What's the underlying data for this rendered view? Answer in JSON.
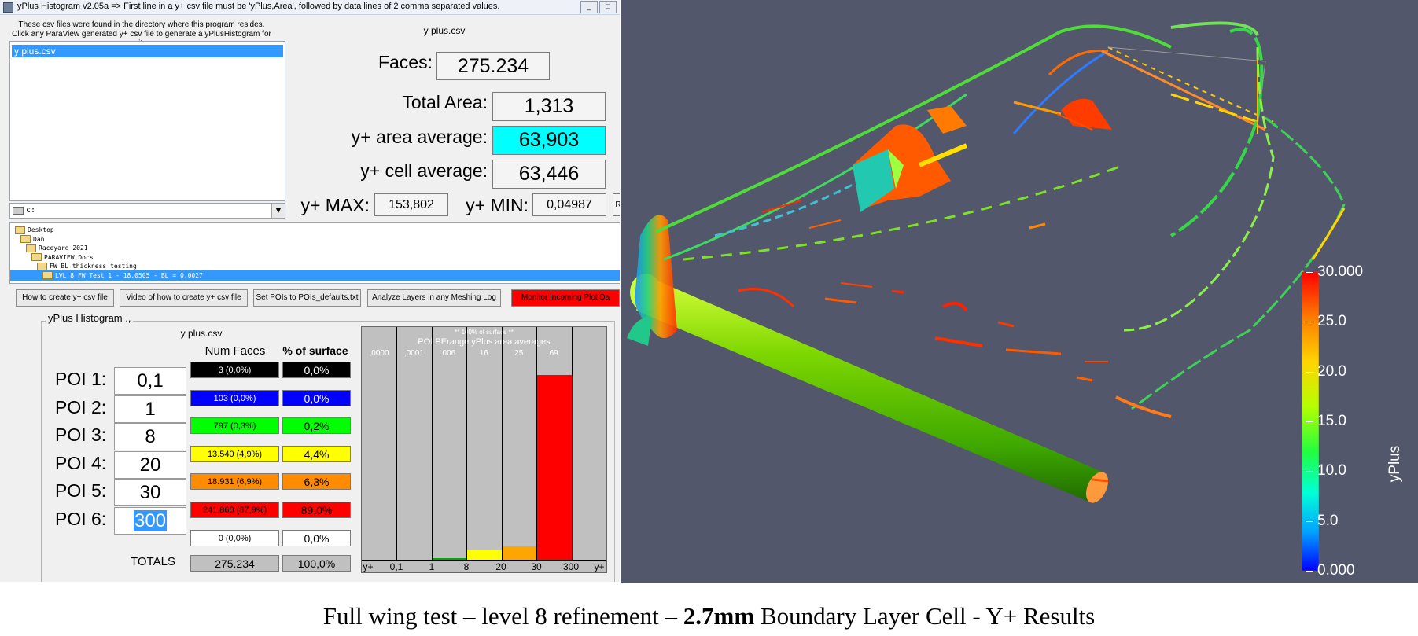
{
  "window": {
    "title": "yPlus Histogram v2.05a => First line in a y+ csv file must be 'yPlus,Area', followed by data lines of 2 comma separated values.",
    "minimize": "_",
    "maximize": "□"
  },
  "hint": {
    "line1": "These csv files were found in the directory where this program resides.",
    "line2": "Click any ParaView generated y+ csv file to generate a yPlusHistogram for it."
  },
  "file_list": {
    "selected": "y plus.csv"
  },
  "drive": {
    "value": "c:",
    "arrow": "▼"
  },
  "tree": [
    {
      "label": "Desktop",
      "indent": 0
    },
    {
      "label": "Dan",
      "indent": 1
    },
    {
      "label": "Raceyard 2021",
      "indent": 2
    },
    {
      "label": "PARAVIEW Docs",
      "indent": 3
    },
    {
      "label": "FW BL thickness testing",
      "indent": 4
    },
    {
      "label": "LVL 8 FW Test 1 - 18.0505 - BL = 0.0027",
      "indent": 5,
      "selected": true
    }
  ],
  "buttons": {
    "how_to": "How to create y+ csv file",
    "video": "Video of how to create y+ csv file",
    "set_pois": "Set POIs to POIs_defaults.txt",
    "analyze": "Analyze Layers in any Meshing Log",
    "monitor": "Monitor Incoming Plot Da"
  },
  "summary": {
    "filename": "y plus.csv",
    "faces_label": "Faces:",
    "faces_value": "275.234",
    "total_area_label": "Total Area:",
    "total_area_value": "1,313",
    "area_avg_label": "y+ area average:",
    "area_avg_value": "63,903",
    "cell_avg_label": "y+ cell average:",
    "cell_avg_value": "63,446",
    "max_label": "y+ MAX:",
    "max_value": "153,802",
    "min_label": "y+ MIN:",
    "min_value": "0,04987",
    "edge_btn": "R"
  },
  "histogram_group": {
    "label": "yPlus Histogram .,",
    "filename": "y plus.csv",
    "col_faces": "Num Faces",
    "col_surface": "% of surface",
    "totals_label": "TOTALS",
    "totals_faces": "275.234",
    "totals_surface": "100,0%"
  },
  "pois": [
    {
      "label": "POI 1:",
      "value": "0,1"
    },
    {
      "label": "POI 2:",
      "value": "1"
    },
    {
      "label": "POI 3:",
      "value": "8"
    },
    {
      "label": "POI 4:",
      "value": "20"
    },
    {
      "label": "POI 5:",
      "value": "30"
    },
    {
      "label": "POI 6:",
      "value": "300",
      "selected": true
    }
  ],
  "rows": [
    {
      "faces": "3 (0,0%)",
      "surface": "0,0%",
      "color": "#000000",
      "text": "#ffffff"
    },
    {
      "faces": "103 (0,0%)",
      "surface": "0,0%",
      "color": "#0000ff",
      "text": "#ffffff"
    },
    {
      "faces": "797 (0,3%)",
      "surface": "0,2%",
      "color": "#00ff00",
      "text": "#000000"
    },
    {
      "faces": "13.540 (4,9%)",
      "surface": "4,4%",
      "color": "#ffff00",
      "text": "#000000"
    },
    {
      "faces": "18.931 (6,9%)",
      "surface": "6,3%",
      "color": "#ff8c00",
      "text": "#000000"
    },
    {
      "faces": "241.860 (87,9%)",
      "surface": "89,0%",
      "color": "#ff0000",
      "text": "#000000"
    },
    {
      "faces": "0 (0,0%)",
      "surface": "0,0%",
      "color": "#ffffff",
      "text": "#000000"
    }
  ],
  "histogram": {
    "top_note": "** 100% of surface **",
    "subtitle": "POI PErange yPlus area averages",
    "averages": [
      ",0000",
      ",0001",
      "006",
      "16",
      "25",
      "69"
    ],
    "x_ticks": [
      "y+",
      "0,1",
      "1",
      "8",
      "20",
      "30",
      "300",
      "y+"
    ],
    "bar_fraction": [
      0,
      0,
      0.002,
      0.044,
      0.063,
      0.89,
      0
    ],
    "bar_colors": [
      "#000000",
      "#0000ff",
      "#00aa00",
      "#ffff00",
      "#ffa500",
      "#ff0000",
      "#ffffff"
    ]
  },
  "colorbar": {
    "title": "yPlus",
    "ticks": [
      "30.000",
      "25.0",
      "20.0",
      "15.0",
      "10.0",
      "5.0",
      "0.000"
    ],
    "colors": [
      "#ff0000",
      "#ff7a00",
      "#ffd400",
      "#b5ff00",
      "#22ff3d",
      "#00ffd8",
      "#00a2ff",
      "#0000ff"
    ]
  },
  "caption": {
    "part1": "Full wing test – level 8 refinement – ",
    "bold": "2.7mm",
    "part2": " Boundary Layer Cell - Y+ Results"
  }
}
